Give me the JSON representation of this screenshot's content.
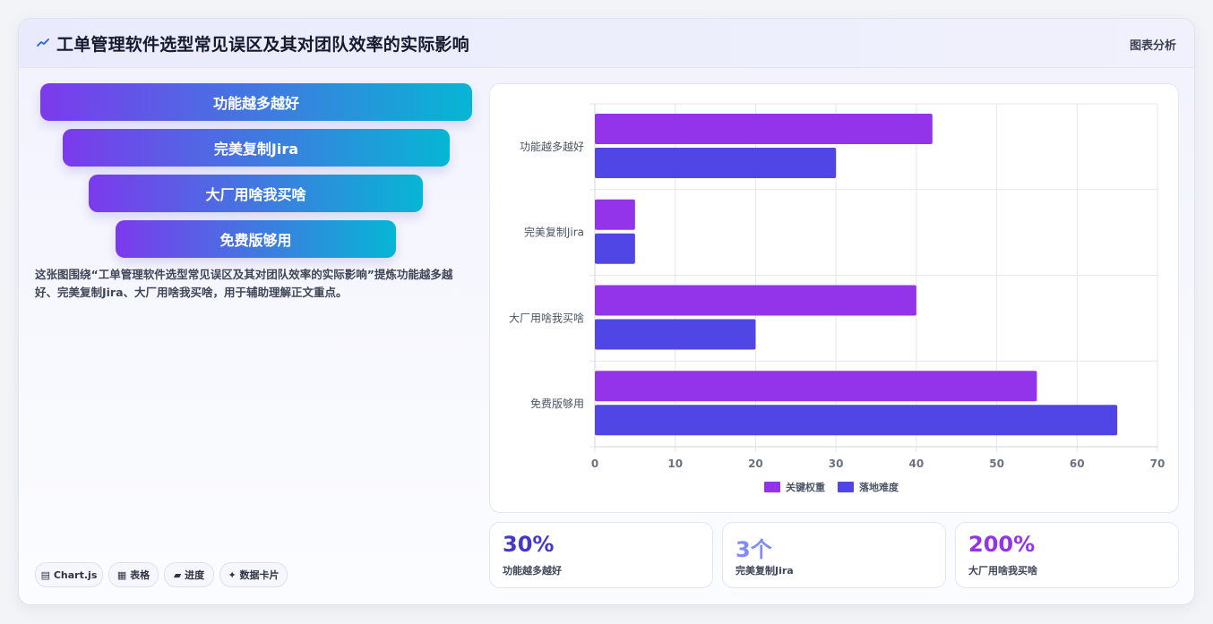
{
  "header": {
    "title": "工单管理软件选型常见误区及其对团队效率的实际影响",
    "tag": "图表分析"
  },
  "funnel": [
    "功能越多越好",
    "完美复制Jira",
    "大厂用啥我买啥",
    "免费版够用"
  ],
  "description": "这张图围绕“工单管理软件选型常见误区及其对团队效率的实际影响”提炼功能越多越好、完美复制Jira、大厂用啥我买啥，用于辅助理解正文重点。",
  "pills": [
    {
      "icon": "bar-chart-icon",
      "glyph": "▤",
      "label": "Chart.js"
    },
    {
      "icon": "table-icon",
      "glyph": "▦",
      "label": "表格"
    },
    {
      "icon": "progress-icon",
      "glyph": "▰",
      "label": "进度"
    },
    {
      "icon": "sparkle-icon",
      "glyph": "✦",
      "label": "数据卡片"
    }
  ],
  "chart_data": {
    "type": "bar",
    "orientation": "horizontal",
    "categories": [
      "功能越多越好",
      "完美复制Jira",
      "大厂用啥我买啥",
      "免费版够用"
    ],
    "series": [
      {
        "name": "关键权重",
        "color": "#9333ea",
        "values": [
          42,
          5,
          40,
          55
        ]
      },
      {
        "name": "落地难度",
        "color": "#4f46e5",
        "values": [
          30,
          5,
          20,
          65
        ]
      }
    ],
    "xlim": [
      0,
      70
    ],
    "xticks": [
      0,
      10,
      20,
      30,
      40,
      50,
      60,
      70
    ],
    "grid": true,
    "legend": "bottom"
  },
  "stats": [
    {
      "value": "30%",
      "label": "功能越多越好",
      "color": "#4338ca"
    },
    {
      "value": "3个",
      "label": "完美复制Jira",
      "color": "#818cf8"
    },
    {
      "value": "200%",
      "label": "大厂用啥我买啥",
      "color": "#9333ea"
    }
  ]
}
